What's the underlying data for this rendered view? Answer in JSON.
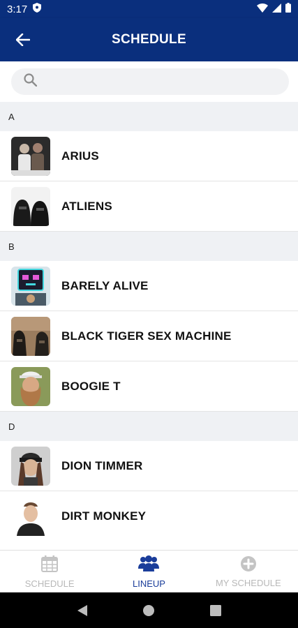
{
  "status_bar": {
    "time": "3:17"
  },
  "header": {
    "title": "SCHEDULE"
  },
  "search": {
    "placeholder": ""
  },
  "sections": [
    {
      "letter": "A",
      "artists": [
        {
          "name": "ARIUS"
        },
        {
          "name": "ATLIENS"
        }
      ]
    },
    {
      "letter": "B",
      "artists": [
        {
          "name": "BARELY ALIVE"
        },
        {
          "name": "BLACK TIGER SEX MACHINE"
        },
        {
          "name": "BOOGIE T"
        }
      ]
    },
    {
      "letter": "D",
      "artists": [
        {
          "name": "DION TIMMER"
        },
        {
          "name": "DIRT MONKEY"
        }
      ]
    }
  ],
  "tabs": [
    {
      "label": "SCHEDULE",
      "icon": "calendar-icon",
      "active": false
    },
    {
      "label": "LINEUP",
      "icon": "people-icon",
      "active": true
    },
    {
      "label": "MY SCHEDULE",
      "icon": "add-circle-icon",
      "active": false
    }
  ],
  "colors": {
    "header_bg": "#0a2f7d",
    "active_tab": "#1a3d9a",
    "inactive_tab": "#b8b8b8",
    "section_bg": "#eff1f4"
  }
}
